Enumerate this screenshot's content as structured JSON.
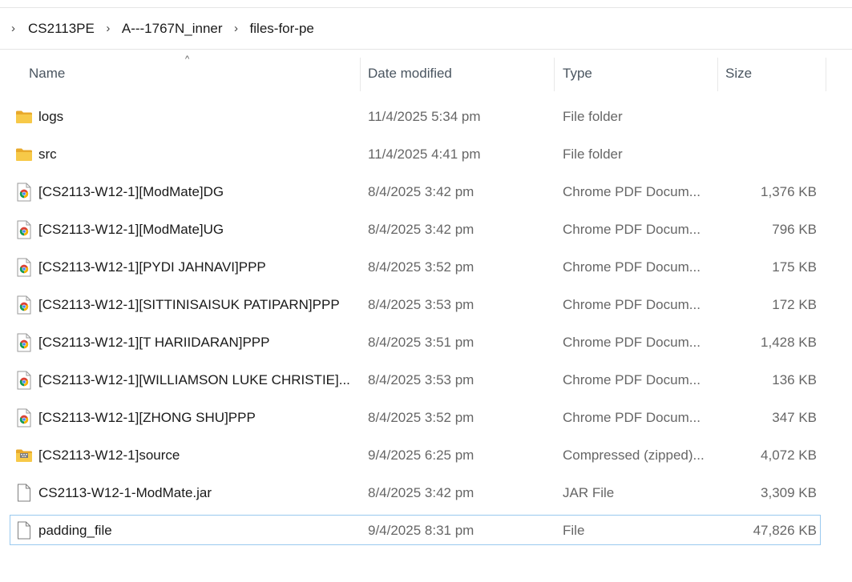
{
  "breadcrumb": {
    "items": [
      "CS2113PE",
      "A---1767N_inner",
      "files-for-pe"
    ]
  },
  "columns": {
    "name": "Name",
    "date": "Date modified",
    "type": "Type",
    "size": "Size"
  },
  "icons": {
    "folder": "folder-icon",
    "pdf": "chrome-pdf-icon",
    "zip": "zip-folder-icon",
    "file": "file-icon"
  },
  "colors": {
    "folder": "#f5c342",
    "selection_border": "#99c9ef"
  },
  "files": [
    {
      "icon": "folder",
      "name": "logs",
      "date": "11/4/2025 5:34 pm",
      "type": "File folder",
      "size": ""
    },
    {
      "icon": "folder",
      "name": "src",
      "date": "11/4/2025 4:41 pm",
      "type": "File folder",
      "size": ""
    },
    {
      "icon": "pdf",
      "name": "[CS2113-W12-1][ModMate]DG",
      "date": "8/4/2025 3:42 pm",
      "type": "Chrome PDF Docum...",
      "size": "1,376 KB"
    },
    {
      "icon": "pdf",
      "name": "[CS2113-W12-1][ModMate]UG",
      "date": "8/4/2025 3:42 pm",
      "type": "Chrome PDF Docum...",
      "size": "796 KB"
    },
    {
      "icon": "pdf",
      "name": "[CS2113-W12-1][PYDI JAHNAVI]PPP",
      "date": "8/4/2025 3:52 pm",
      "type": "Chrome PDF Docum...",
      "size": "175 KB"
    },
    {
      "icon": "pdf",
      "name": "[CS2113-W12-1][SITTINISAISUK PATIPARN]PPP",
      "date": "8/4/2025 3:53 pm",
      "type": "Chrome PDF Docum...",
      "size": "172 KB"
    },
    {
      "icon": "pdf",
      "name": "[CS2113-W12-1][T HARIIDARAN]PPP",
      "date": "8/4/2025 3:51 pm",
      "type": "Chrome PDF Docum...",
      "size": "1,428 KB"
    },
    {
      "icon": "pdf",
      "name": "[CS2113-W12-1][WILLIAMSON LUKE CHRISTIE]...",
      "date": "8/4/2025 3:53 pm",
      "type": "Chrome PDF Docum...",
      "size": "136 KB"
    },
    {
      "icon": "pdf",
      "name": "[CS2113-W12-1][ZHONG SHU]PPP",
      "date": "8/4/2025 3:52 pm",
      "type": "Chrome PDF Docum...",
      "size": "347 KB"
    },
    {
      "icon": "zip",
      "name": "[CS2113-W12-1]source",
      "date": "9/4/2025 6:25 pm",
      "type": "Compressed (zipped)...",
      "size": "4,072 KB"
    },
    {
      "icon": "file",
      "name": "CS2113-W12-1-ModMate.jar",
      "date": "8/4/2025 3:42 pm",
      "type": "JAR File",
      "size": "3,309 KB"
    },
    {
      "icon": "file",
      "name": "padding_file",
      "date": "9/4/2025 8:31 pm",
      "type": "File",
      "size": "47,826 KB",
      "selected": true
    }
  ]
}
